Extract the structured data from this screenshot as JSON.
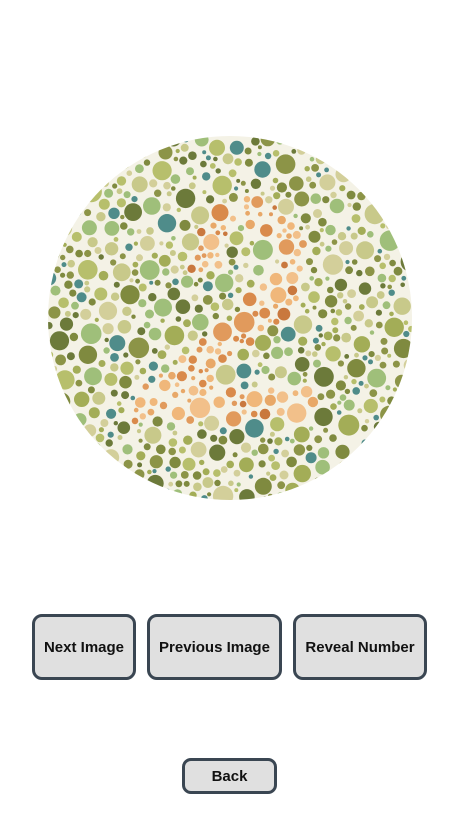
{
  "plate": {
    "description_icon": "ishihara-color-plate",
    "hidden_number": "2",
    "colors": {
      "background_dots": [
        "#b7bf6c",
        "#a3ad57",
        "#8c9447",
        "#c8c98a",
        "#7f8a3f",
        "#9fbf7a",
        "#4f8c8a",
        "#6c7a3a",
        "#d3cf9a"
      ],
      "figure_dots": [
        "#e19a5c",
        "#f0b77a",
        "#d98a4b",
        "#c9783e",
        "#e8a868",
        "#f2c08a"
      ]
    }
  },
  "buttons": {
    "next_label": "Next Image",
    "previous_label": "Previous Image",
    "reveal_label": "Reveal Number",
    "back_label": "Back"
  }
}
